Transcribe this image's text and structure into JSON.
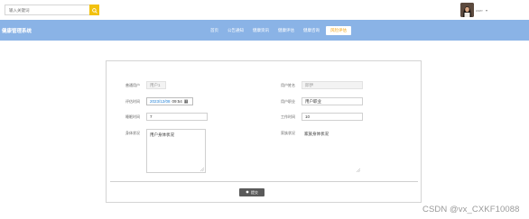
{
  "header": {
    "search": {
      "placeholder": "输入关键词",
      "value": ""
    },
    "user": {
      "name": "user"
    }
  },
  "nav": {
    "site_title": "健康管理系统",
    "items": [
      {
        "label": "首页",
        "active": false
      },
      {
        "label": "公告通知",
        "active": false
      },
      {
        "label": "健康资讯",
        "active": false
      },
      {
        "label": "健康评估",
        "active": false
      },
      {
        "label": "健康咨询",
        "active": false
      },
      {
        "label": "风险评估",
        "active": true
      }
    ]
  },
  "form": {
    "user_account": {
      "label": "普通用户",
      "value": "用户1"
    },
    "user_name": {
      "label": "用户姓名",
      "value": "邱伊"
    },
    "eval_time": {
      "label": "评估时间",
      "value_date": "2023/12/08",
      "value_time": "09:54"
    },
    "user_job": {
      "label": "用户职业",
      "value": "用户职业"
    },
    "sleep_hours": {
      "label": "睡眠时间",
      "value": "7"
    },
    "work_hours": {
      "label": "工作时间",
      "value": "10"
    },
    "body_status": {
      "label": "身体状况",
      "value": "用户身体状况"
    },
    "family_status": {
      "label": "家族状况",
      "value": "家族身体状况"
    }
  },
  "actions": {
    "submit_label": "提交"
  },
  "watermark": "CSDN @vx_CXKF10088",
  "colors": {
    "navbar": "#8ab3e6",
    "accent": "#f2c10d",
    "active_nav_text": "#f2a413",
    "submit_bg": "#5a5a5a"
  }
}
